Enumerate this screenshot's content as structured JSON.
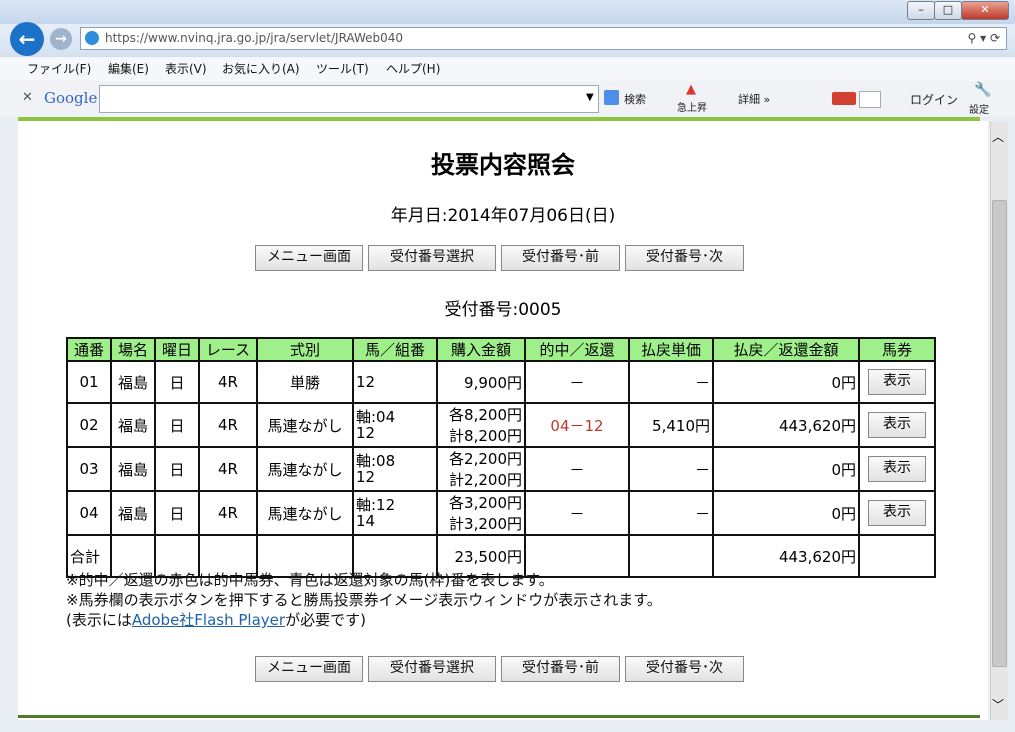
{
  "browser": {
    "url": "https://www.nvinq.jra.go.jp/jra/servlet/JRAWeb040",
    "menu": [
      "ファイル(F)",
      "編集(E)",
      "表示(V)",
      "お気に入り(A)",
      "ツール(T)",
      "ヘルプ(H)"
    ],
    "google_label": "Google",
    "search_label": "検索",
    "rising_label": "急上昇",
    "detail_label": "詳細 »",
    "login_label": "ログイン",
    "settings_label": "設定"
  },
  "page": {
    "title": "投票内容照会",
    "date": "年月日:2014年07月06日(日)",
    "receipt": "受付番号:0005",
    "buttons": [
      "メニュー画面",
      "受付番号選択",
      "受付番号･前",
      "受付番号･次"
    ],
    "headers": [
      "通番",
      "場名",
      "曜日",
      "レース",
      "式別",
      "馬／組番",
      "購入金額",
      "的中／返還",
      "払戻単価",
      "払戻／返還金額",
      "馬券"
    ],
    "rows": [
      {
        "no": "01",
        "place": "福島",
        "day": "日",
        "race": "4R",
        "type": "単勝",
        "combo1": "12",
        "combo2": "",
        "amt1": "9,900円",
        "amt2": "",
        "hit": "－",
        "hit_red": false,
        "unit": "－",
        "payout": "0円",
        "btn": "表示"
      },
      {
        "no": "02",
        "place": "福島",
        "day": "日",
        "race": "4R",
        "type": "馬連ながし",
        "combo1": "軸:04",
        "combo2": "12",
        "amt1": "各8,200円",
        "amt2": "計8,200円",
        "hit": "04－12",
        "hit_red": true,
        "unit": "5,410円",
        "payout": "443,620円",
        "btn": "表示"
      },
      {
        "no": "03",
        "place": "福島",
        "day": "日",
        "race": "4R",
        "type": "馬連ながし",
        "combo1": "軸:08",
        "combo2": "12",
        "amt1": "各2,200円",
        "amt2": "計2,200円",
        "hit": "－",
        "hit_red": false,
        "unit": "－",
        "payout": "0円",
        "btn": "表示"
      },
      {
        "no": "04",
        "place": "福島",
        "day": "日",
        "race": "4R",
        "type": "馬連ながし",
        "combo1": "軸:12",
        "combo2": "14",
        "amt1": "各3,200円",
        "amt2": "計3,200円",
        "hit": "－",
        "hit_red": false,
        "unit": "－",
        "payout": "0円",
        "btn": "表示"
      }
    ],
    "total_label": "合計",
    "total_amount": "23,500円",
    "total_payout": "443,620円",
    "note1": "※的中／返還の赤色は的中馬券、青色は返還対象の馬(枠)番を表します。",
    "note2": "※馬券欄の表示ボタンを押下すると勝馬投票券イメージ表示ウィンドウが表示されます。",
    "note3_pre": "(表示には",
    "note3_link": "Adobe社Flash Player",
    "note3_post": "が必要です)"
  },
  "colors": {
    "header_bg": "#9ff08b",
    "hit_red": "#c0392b",
    "green_bar": "#8cc63f",
    "link": "#1d63a8"
  }
}
